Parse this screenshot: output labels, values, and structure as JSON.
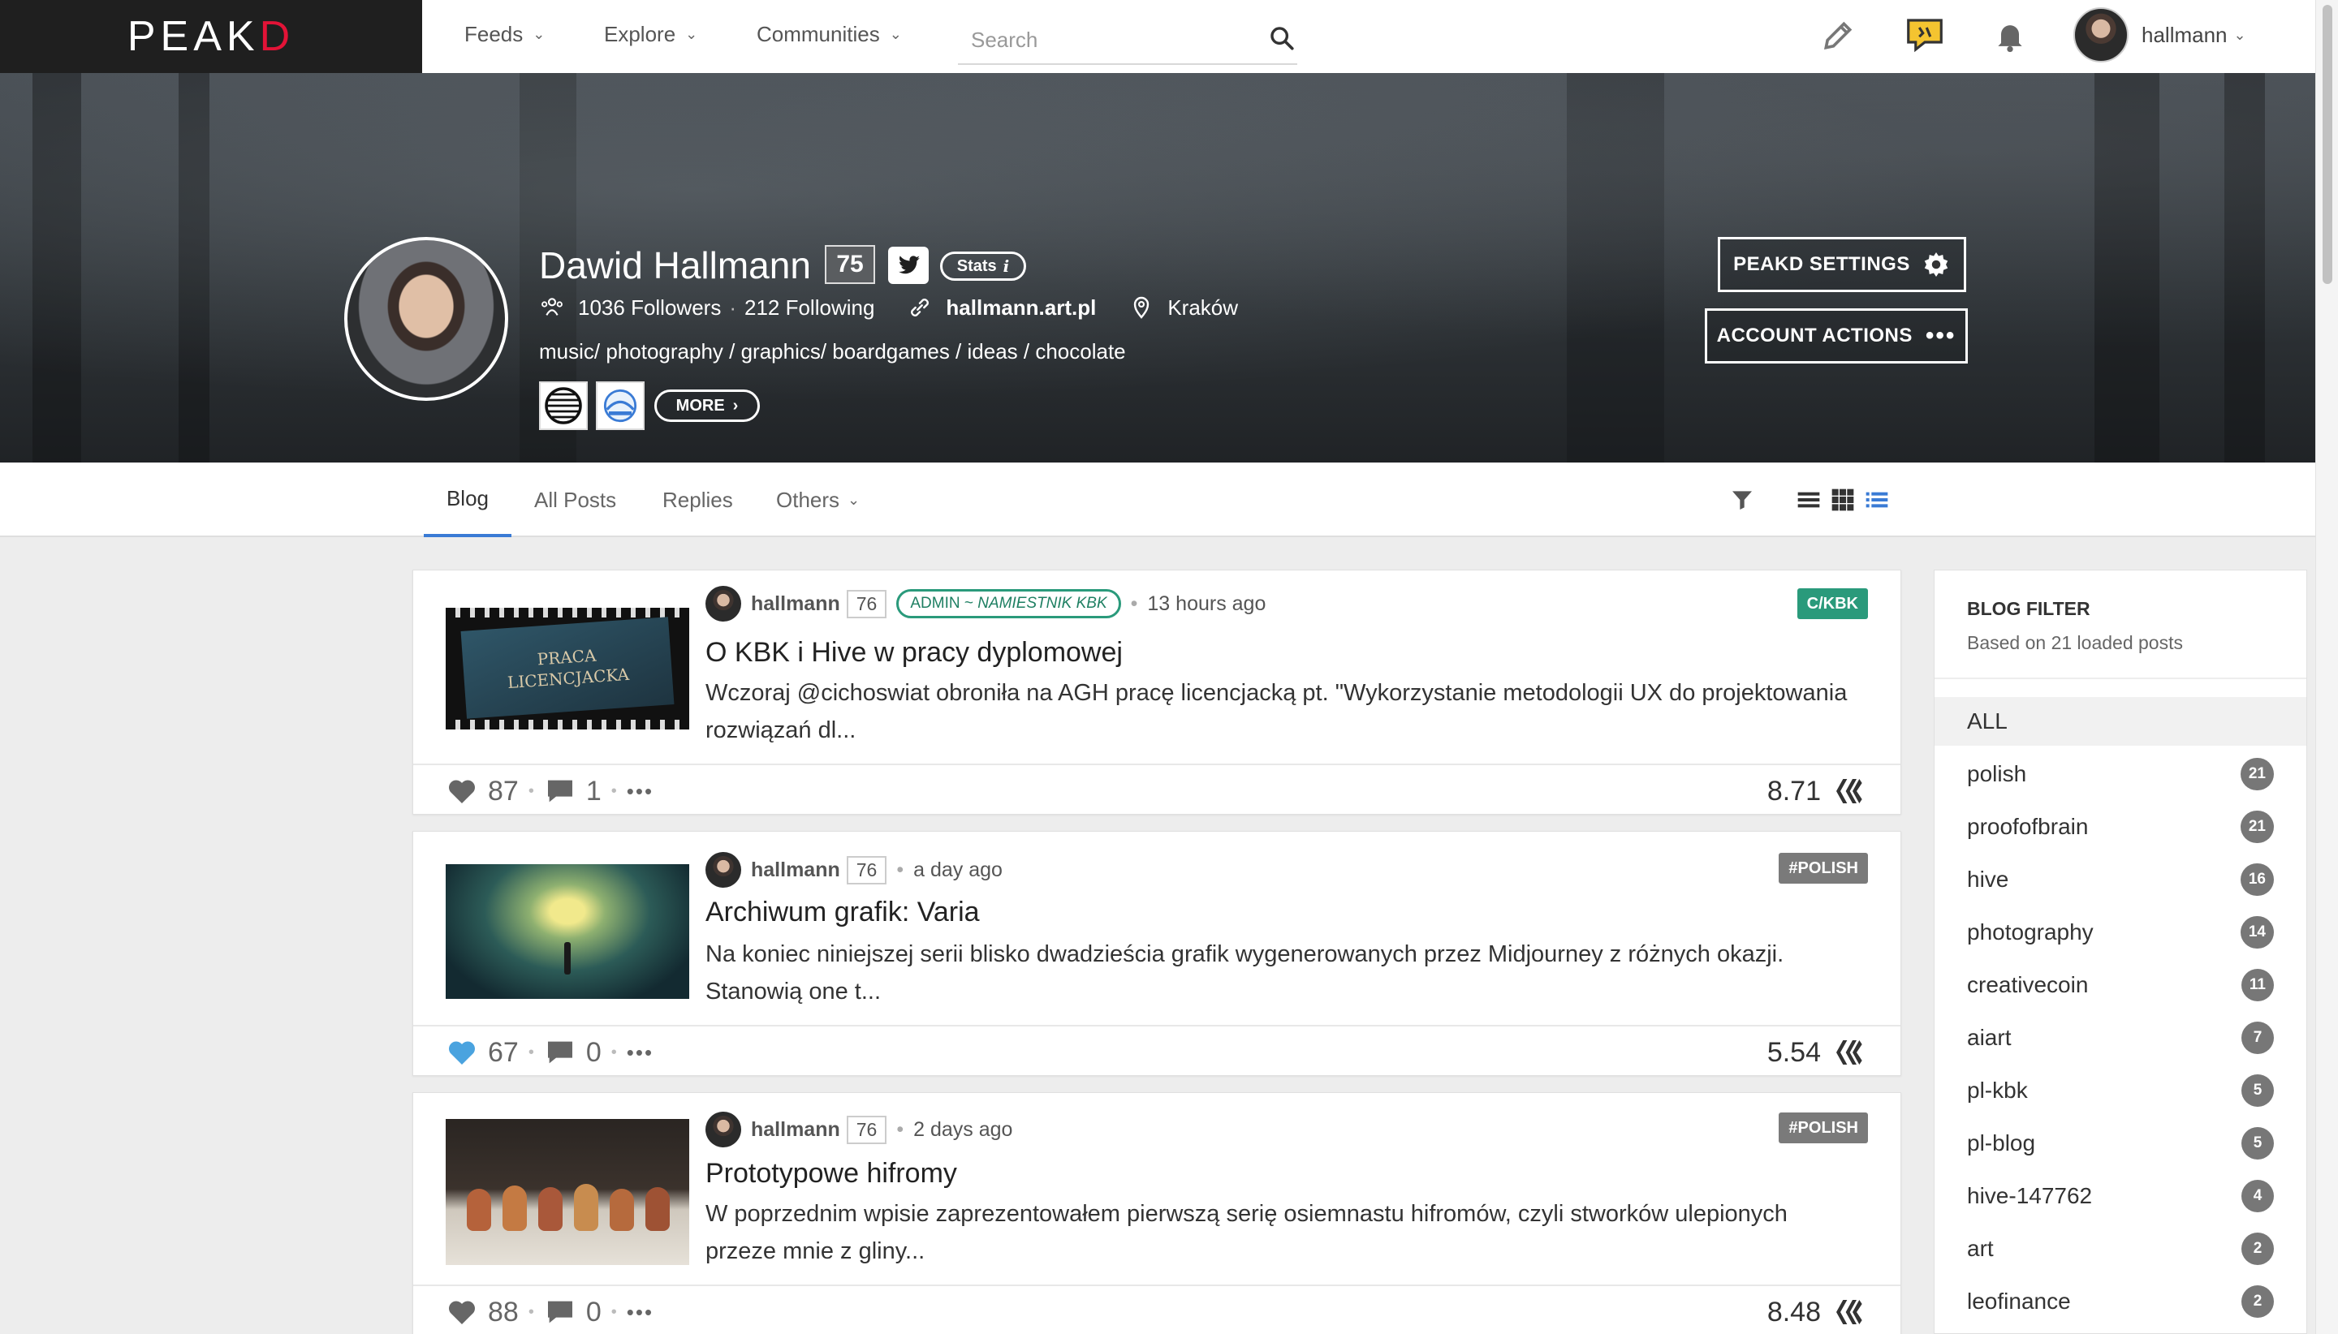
{
  "nav": {
    "logo_prefix": "PEAK",
    "logo_accent": "D",
    "feeds": "Feeds",
    "explore": "Explore",
    "communities": "Communities",
    "search_placeholder": "Search",
    "username": "hallmann"
  },
  "profile": {
    "name": "Dawid Hallmann",
    "reputation": "75",
    "stats_label": "Stats",
    "followers": "1036 Followers",
    "following": "212 Following",
    "website": "hallmann.art.pl",
    "location": "Kraków",
    "bio": "music/ photography / graphics/ boardgames / ideas / chocolate",
    "more_label": "MORE",
    "settings_label": "PEAKD SETTINGS",
    "account_actions_label": "ACCOUNT ACTIONS"
  },
  "tabs": {
    "blog": "Blog",
    "all_posts": "All Posts",
    "replies": "Replies",
    "others": "Others"
  },
  "posts": [
    {
      "author": "hallmann",
      "rep": "76",
      "role_prefix": "ADMIN ~ ",
      "role_title": "NAMIESTNIK KBK",
      "time": "13 hours ago",
      "tag": "C/KBK",
      "title": "O KBK i Hive w pracy dyplomowej",
      "body": "Wczoraj @cichoswiat obroniła na AGH pracę licencjacką pt. \"Wykorzystanie metodologii UX do projektowania rozwiązań dl...",
      "thumb_text": "PRACA LICENCJACKA",
      "votes": "87",
      "comments": "1",
      "payout": "8.71",
      "liked": false
    },
    {
      "author": "hallmann",
      "rep": "76",
      "time": "a day ago",
      "tag": "#POLISH",
      "title": "Archiwum grafik: Varia",
      "body": "Na koniec niniejszej serii blisko dwadzieścia grafik wygenerowanych przez Midjourney z różnych okazji. Stanowią one t...",
      "votes": "67",
      "comments": "0",
      "payout": "5.54",
      "liked": true
    },
    {
      "author": "hallmann",
      "rep": "76",
      "time": "2 days ago",
      "tag": "#POLISH",
      "title": "Prototypowe hifromy",
      "body": "W poprzednim wpisie zaprezentowałem pierwszą serię osiemnastu hifromów, czyli stworków ulepionych przeze mnie z gliny...",
      "votes": "88",
      "comments": "0",
      "payout": "8.48",
      "liked": false
    }
  ],
  "sidebar": {
    "title": "BLOG FILTER",
    "subtitle": "Based on 21 loaded posts",
    "all_label": "ALL",
    "items": [
      {
        "label": "polish",
        "count": "21"
      },
      {
        "label": "proofofbrain",
        "count": "21"
      },
      {
        "label": "hive",
        "count": "16"
      },
      {
        "label": "photography",
        "count": "14"
      },
      {
        "label": "creativecoin",
        "count": "11"
      },
      {
        "label": "aiart",
        "count": "7"
      },
      {
        "label": "pl-kbk",
        "count": "5"
      },
      {
        "label": "pl-blog",
        "count": "5"
      },
      {
        "label": "hive-147762",
        "count": "4"
      },
      {
        "label": "art",
        "count": "2"
      },
      {
        "label": "leofinance",
        "count": "2"
      }
    ]
  },
  "colors": {
    "brand_red": "#e31337",
    "tab_active": "#3a7bd5",
    "tag_community": "#2a9a7b",
    "tag_hashtag": "#7a7a7a",
    "like_active": "#4aa3df"
  }
}
